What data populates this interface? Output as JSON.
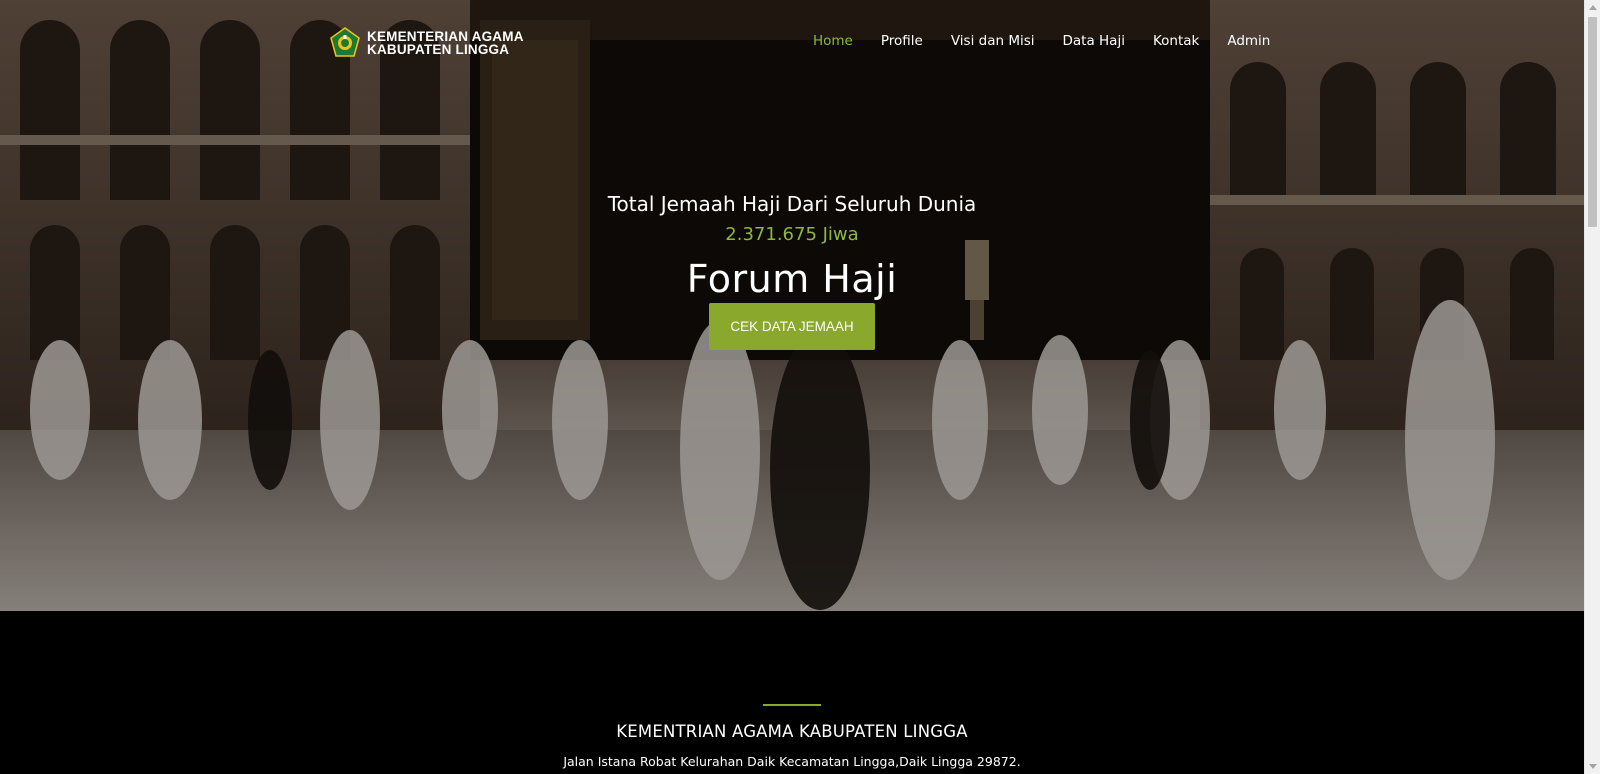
{
  "header": {
    "logo_line1": "KEMENTERIAN AGAMA",
    "logo_line2": "KABUPATEN LINGGA",
    "logo_icon": "kemenag-emblem-icon",
    "nav": [
      {
        "label": "Home",
        "active": true
      },
      {
        "label": "Profile",
        "active": false
      },
      {
        "label": "Visi dan Misi",
        "active": false
      },
      {
        "label": "Data Haji",
        "active": false
      },
      {
        "label": "Kontak",
        "active": false
      },
      {
        "label": "Admin",
        "active": false
      }
    ]
  },
  "hero": {
    "subtitle": "Total Jemaah Haji Dari Seluruh Dunia",
    "count": "2.371.675 Jiwa",
    "title": "Forum Haji",
    "cta_label": "CEK DATA JEMAAH",
    "background": "kaaba-pilgrims-photo"
  },
  "footer": {
    "title": "KEMENTRIAN AGAMA KABUPATEN LINGGA",
    "address": "Jalan Istana Robat Kelurahan Daik Kecamatan Lingga,Daik Lingga 29872."
  },
  "colors": {
    "accent": "#8fb839",
    "button": "#8aa92c",
    "footer_bg": "#000000"
  }
}
